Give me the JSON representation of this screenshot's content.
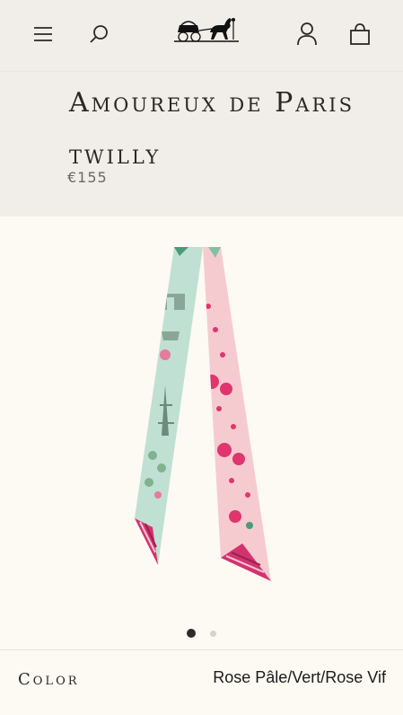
{
  "header": {
    "menu_icon": "hamburger-menu-icon",
    "search_icon": "search-icon",
    "logo": "horse-carriage-logo",
    "account_icon": "user-account-icon",
    "bag_icon": "shopping-bag-icon"
  },
  "product": {
    "name": "Amoureux de Paris twilly",
    "price": "€155"
  },
  "gallery": {
    "image_count": 2,
    "active_index": 0,
    "scarf_colors": {
      "left_band": "#bfe0d2",
      "right_band": "#f6cbd0",
      "accent_pink": "#e0356e",
      "stripe": "#d2336f"
    }
  },
  "color": {
    "label": "Color",
    "value": "Rose Pâle/Vert/Rose Vif"
  }
}
